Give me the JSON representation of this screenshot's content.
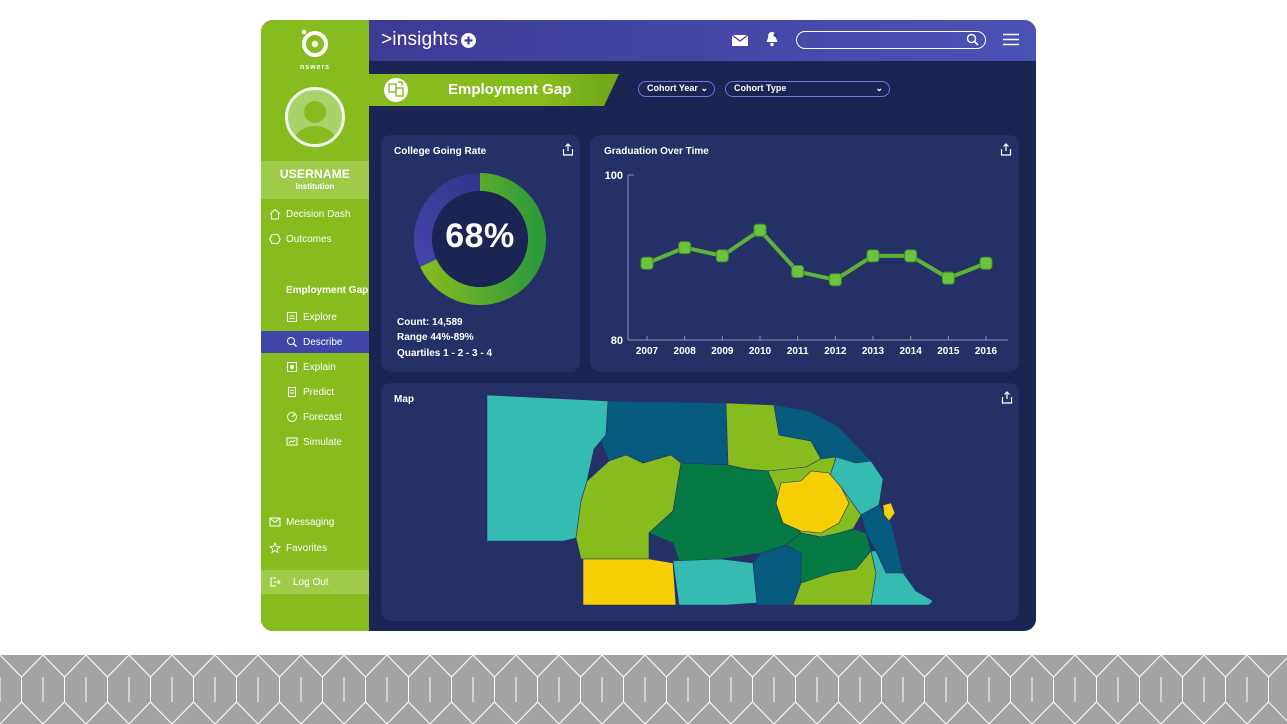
{
  "header": {
    "brand": ">insights",
    "search_placeholder": ""
  },
  "sidebar": {
    "brand_text": "nswers",
    "username": "USERNAME",
    "institution": "Institution",
    "top_items": [
      {
        "label": "Decision Dash",
        "icon": "home-icon"
      },
      {
        "label": "Outcomes",
        "icon": "hexagon-icon"
      }
    ],
    "section_title": "Employment Gap",
    "sub_items": [
      {
        "label": "Explore",
        "icon": "explore-icon"
      },
      {
        "label": "Describe",
        "icon": "describe-icon",
        "active": true
      },
      {
        "label": "Explain",
        "icon": "explain-icon"
      },
      {
        "label": "Predict",
        "icon": "predict-icon"
      },
      {
        "label": "Forecast",
        "icon": "forecast-icon"
      },
      {
        "label": "Simulate",
        "icon": "simulate-icon"
      }
    ],
    "bottom_items": [
      {
        "label": "Messaging",
        "icon": "messaging-icon"
      },
      {
        "label": "Favorites",
        "icon": "star-icon"
      }
    ],
    "logout": "Log Out"
  },
  "page": {
    "title": "Employment Gap",
    "filters": [
      "Cohort Year",
      "Cohort Type"
    ]
  },
  "college_card": {
    "title": "College Going Rate",
    "value_text": "68%",
    "value": 68,
    "count": "Count: 14,589",
    "range": "Range 44%-89%",
    "quartiles": "Quartiles 1 - 2 - 3 - 4"
  },
  "chart_data": {
    "type": "line",
    "title": "Graduation Over Time",
    "x": [
      "2007",
      "2008",
      "2009",
      "2010",
      "2011",
      "2012",
      "2013",
      "2014",
      "2015",
      "2016"
    ],
    "values": [
      89.3,
      91.2,
      90.2,
      93.3,
      88.3,
      87.3,
      90.2,
      90.2,
      87.5,
      89.3
    ],
    "ylim": [
      80,
      100
    ],
    "yticks": [
      "100",
      "80"
    ],
    "grid": false,
    "legend": "none",
    "line_color": "#5db33a"
  },
  "map_card": {
    "title": "Map"
  },
  "colors": {
    "sidebar": "#86bc1e",
    "header": "#4347a8",
    "app_bg": "#1b2453",
    "card": "#253067",
    "map_teal": "#35bcb0",
    "map_navy": "#065a7e",
    "map_lime": "#86bc1e",
    "map_green": "#067a44",
    "map_yellow": "#f6cf04"
  }
}
